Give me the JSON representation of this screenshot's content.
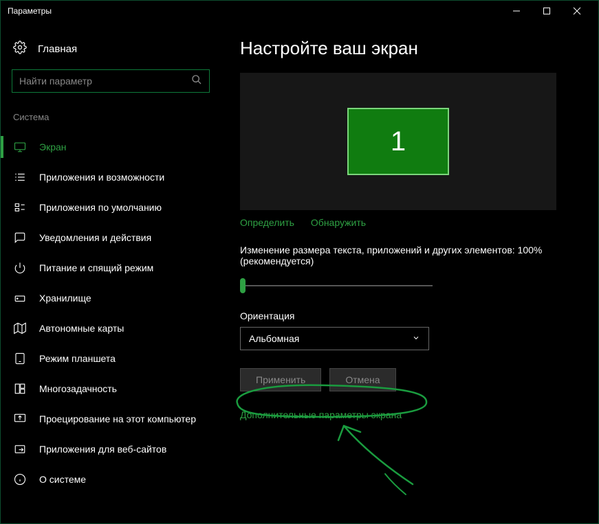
{
  "window": {
    "title": "Параметры"
  },
  "sidebar": {
    "home": "Главная",
    "search_placeholder": "Найти параметр",
    "section": "Система",
    "items": [
      {
        "label": "Экран"
      },
      {
        "label": "Приложения и возможности"
      },
      {
        "label": "Приложения по умолчанию"
      },
      {
        "label": "Уведомления и действия"
      },
      {
        "label": "Питание и спящий режим"
      },
      {
        "label": "Хранилище"
      },
      {
        "label": "Автономные карты"
      },
      {
        "label": "Режим планшета"
      },
      {
        "label": "Многозадачность"
      },
      {
        "label": "Проецирование на этот компьютер"
      },
      {
        "label": "Приложения для веб-сайтов"
      },
      {
        "label": "О системе"
      }
    ]
  },
  "main": {
    "title": "Настройте ваш экран",
    "monitor_number": "1",
    "identify": "Определить",
    "detect": "Обнаружить",
    "scale_text": "Изменение размера текста, приложений и других элементов: 100% (рекомендуется)",
    "orientation_label": "Ориентация",
    "orientation_value": "Альбомная",
    "apply": "Применить",
    "cancel": "Отмена",
    "advanced": "Дополнительные параметры экрана"
  },
  "colors": {
    "accent": "#2ea043",
    "monitor_bg": "#107c10"
  }
}
